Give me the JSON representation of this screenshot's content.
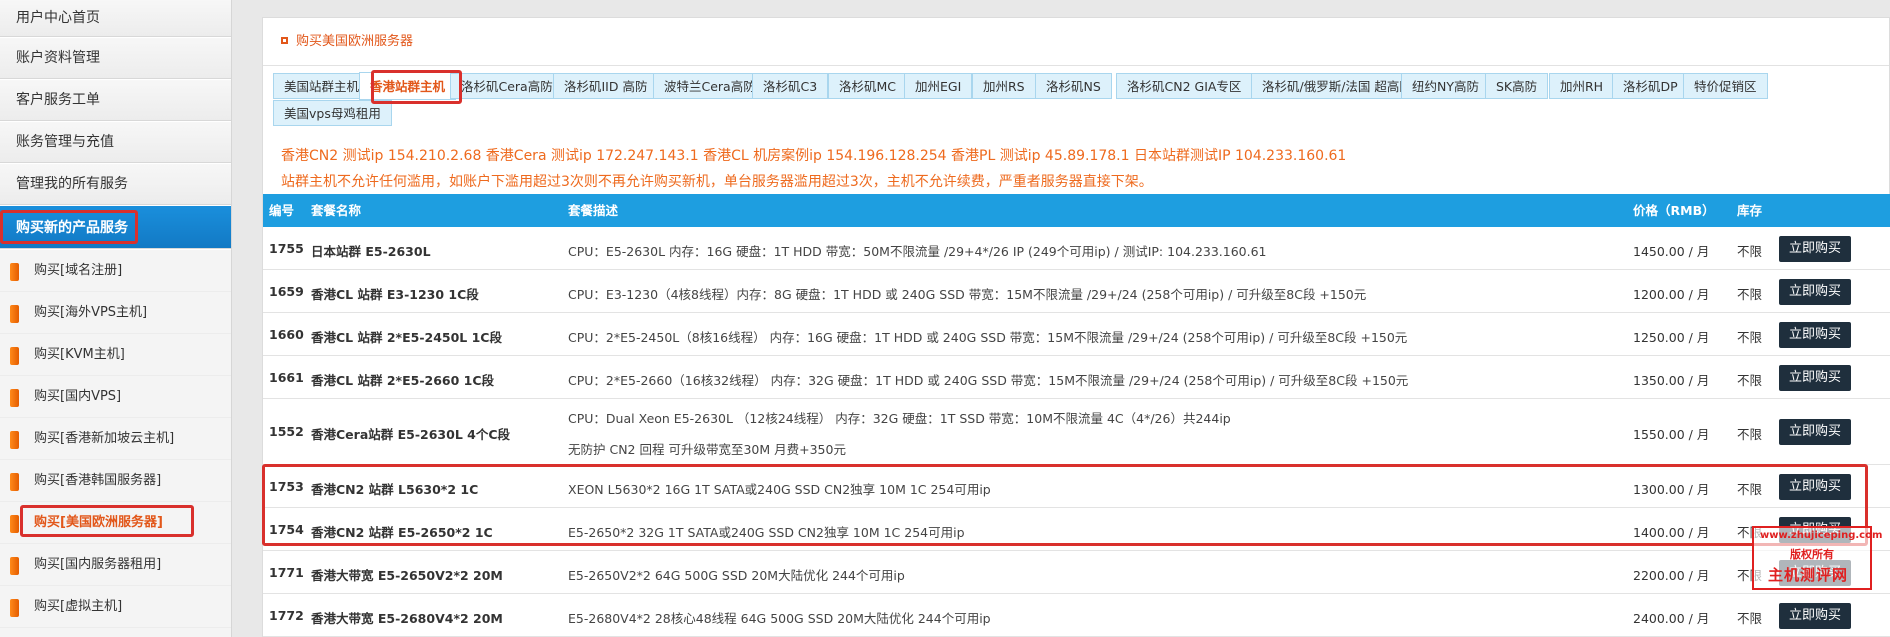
{
  "sidebar": {
    "top_items": [
      "用户中心首页",
      "账户资料管理",
      "客户服务工单",
      "账务管理与充值",
      "管理我的所有服务"
    ],
    "active_item": "购买新的产品服务",
    "sub_items": [
      "购买[域名注册]",
      "购买[海外VPS主机]",
      "购买[KVM主机]",
      "购买[国内VPS]",
      "购买[香港新加坡云主机]",
      "购买[香港韩国服务器]",
      "购买[美国欧洲服务器]",
      "购买[国内服务器租用]",
      "购买[虚拟主机]"
    ],
    "active_sub_index": 6
  },
  "panel": {
    "title": "购买美国欧洲服务器"
  },
  "tabs": [
    "美国站群主机",
    "香港站群主机",
    "洛杉矶Cera高防",
    "洛杉矶IID 高防",
    "波特兰Cera高防",
    "洛杉矶C3",
    "洛杉矶MC",
    "加州EGI",
    "加州RS",
    "洛杉矶NS",
    "洛杉矶CN2 GIA专区",
    "洛杉矶/俄罗斯/法国 超高防",
    "纽约NY高防",
    "SK高防",
    "加州RH",
    "洛杉矶DP",
    "特价促销区",
    "美国vps母鸡租用"
  ],
  "active_tab_index": 1,
  "notice": {
    "line1": "香港CN2 测试ip 154.210.2.68 香港Cera 测试ip 172.247.143.1 香港CL 机房案例ip 154.196.128.254 香港PL 测试ip 45.89.178.1 日本站群测试IP 104.233.160.61",
    "line2": "站群主机不允许任何滥用，如账户下滥用超过3次则不再允许购买新机，单台服务器滥用超过3次，主机不允许续费，严重者服务器直接下架。"
  },
  "table": {
    "headers": {
      "id": "编号",
      "name": "套餐名称",
      "desc": "套餐描述",
      "price": "价格（RMB）",
      "stock": "库存"
    },
    "buy_label": "立即购买",
    "rows": [
      {
        "id": "1755",
        "name": "日本站群 E5-2630L",
        "desc": [
          "CPU：E5-2630L 内存：16G 硬盘：1T HDD 带宽：50M不限流量 /29+4*/26 IP (249个可用ip) / 测试IP: 104.233.160.61"
        ],
        "price": "1450.00 / 月",
        "stock": "不限"
      },
      {
        "id": "1659",
        "name": "香港CL 站群 E3-1230 1C段",
        "desc": [
          "CPU：E3-1230（4核8线程）内存：8G 硬盘：1T HDD 或 240G SSD 带宽：15M不限流量 /29+/24 (258个可用ip) / 可升级至8C段 +150元"
        ],
        "price": "1200.00 / 月",
        "stock": "不限"
      },
      {
        "id": "1660",
        "name": "香港CL 站群 2*E5-2450L 1C段",
        "desc": [
          "CPU：2*E5-2450L（8核16线程） 内存：16G 硬盘：1T HDD 或 240G SSD 带宽：15M不限流量 /29+/24 (258个可用ip) / 可升级至8C段 +150元"
        ],
        "price": "1250.00 / 月",
        "stock": "不限"
      },
      {
        "id": "1661",
        "name": "香港CL 站群 2*E5-2660 1C段",
        "desc": [
          "CPU：2*E5-2660（16核32线程） 内存：32G 硬盘：1T HDD 或 240G SSD 带宽：15M不限流量 /29+/24 (258个可用ip) / 可升级至8C段 +150元"
        ],
        "price": "1350.00 / 月",
        "stock": "不限"
      },
      {
        "id": "1552",
        "name": "香港Cera站群 E5-2630L 4个C段",
        "desc": [
          "CPU：Dual Xeon E5-2630L （12核24线程） 内存：32G 硬盘：1T SSD 带宽：10M不限流量 4C（4*/26）共244ip",
          "无防护 CN2 回程 可升级带宽至30M 月费+350元"
        ],
        "price": "1550.00 / 月",
        "stock": "不限"
      },
      {
        "id": "1753",
        "name": "香港CN2 站群 L5630*2 1C",
        "desc": [
          "XEON L5630*2 16G 1T SATA或240G SSD CN2独享 10M 1C 254可用ip"
        ],
        "price": "1300.00 / 月",
        "stock": "不限"
      },
      {
        "id": "1754",
        "name": "香港CN2 站群 E5-2650*2 1C",
        "desc": [
          "E5-2650*2 32G 1T SATA或240G SSD CN2独享 10M 1C 254可用ip"
        ],
        "price": "1400.00 / 月",
        "stock": "不限"
      },
      {
        "id": "1771",
        "name": "香港大带宽 E5-2650V2*2 20M",
        "desc": [
          "E5-2650V2*2 64G 500G SSD 20M大陆优化 244个可用ip"
        ],
        "price": "2200.00 / 月",
        "stock": "不限"
      },
      {
        "id": "1772",
        "name": "香港大带宽 E5-2680V4*2 20M",
        "desc": [
          "E5-2680V4*2 28核心48线程 64G 500G SSD 20M大陆优化 244个可用ip"
        ],
        "price": "2400.00 / 月",
        "stock": "不限"
      }
    ]
  },
  "watermark": {
    "line1": "www.zhujiceping.com",
    "line2": "版权所有",
    "line3": "主机测评网"
  },
  "colors": {
    "accent_orange": "#e2571a",
    "header_blue": "#1e9ee0",
    "buy_button": "#1f2f3d",
    "highlight_red": "#d9302c"
  }
}
